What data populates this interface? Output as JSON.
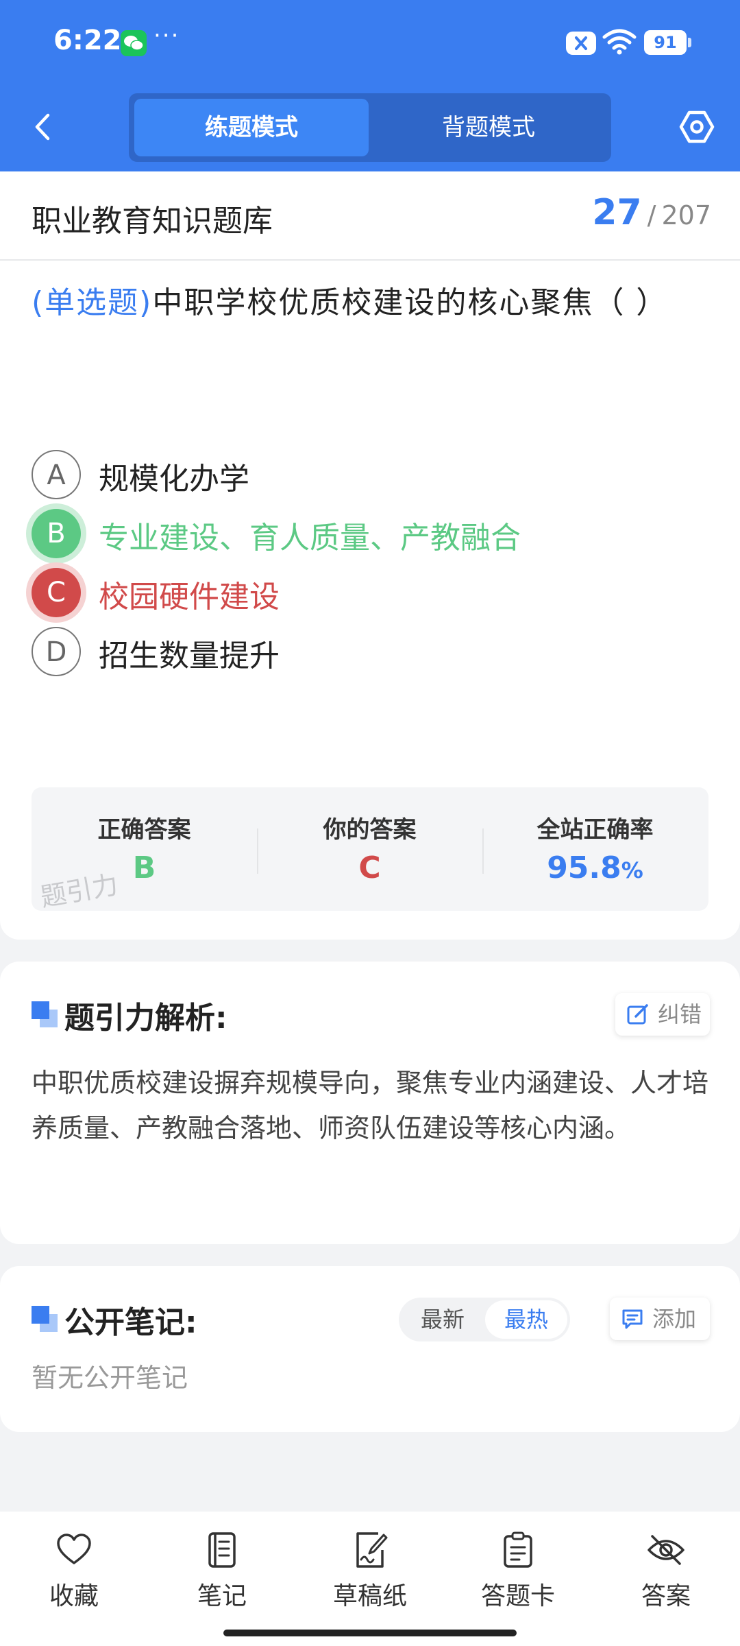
{
  "status_bar": {
    "time": "6:22",
    "overflow": "···",
    "battery": "91"
  },
  "mode_switch": {
    "active": "练题模式",
    "inactive": "背题模式"
  },
  "bank": {
    "title": "职业教育知识题库",
    "current": "27",
    "separator": "/",
    "total": "207"
  },
  "question": {
    "type": "(单选题)",
    "text": "中职学校优质校建设的核心聚焦（    ）"
  },
  "options": [
    {
      "key": "A",
      "text": "规模化办学",
      "state": "normal"
    },
    {
      "key": "B",
      "text": "专业建设、育人质量、产教融合",
      "state": "correct"
    },
    {
      "key": "C",
      "text": "校园硬件建设",
      "state": "wrong"
    },
    {
      "key": "D",
      "text": "招生数量提升",
      "state": "normal"
    }
  ],
  "stats": {
    "correct_label": "正确答案",
    "correct_value": "B",
    "yours_label": "你的答案",
    "yours_value": "C",
    "rate_label": "全站正确率",
    "rate_value": "95.8",
    "rate_unit": "%",
    "watermark": "题引力"
  },
  "analysis": {
    "title": "题引力解析:",
    "report_label": "纠错",
    "text": "中职优质校建设摒弃规模导向，聚焦专业内涵建设、人才培养质量、产教融合落地、师资队伍建设等核心内涵。"
  },
  "notes": {
    "title": "公开笔记:",
    "sort_latest": "最新",
    "sort_hot": "最热",
    "add_label": "添加",
    "empty": "暂无公开笔记"
  },
  "bottom_tabs": [
    {
      "label": "收藏",
      "icon": "heart-icon"
    },
    {
      "label": "笔记",
      "icon": "notebook-icon"
    },
    {
      "label": "草稿纸",
      "icon": "draft-paper-icon"
    },
    {
      "label": "答题卡",
      "icon": "answer-sheet-icon"
    },
    {
      "label": "答案",
      "icon": "eye-off-icon"
    }
  ],
  "colors": {
    "primary": "#3a7df0",
    "correct": "#5cc984",
    "wrong": "#d14a4a"
  }
}
